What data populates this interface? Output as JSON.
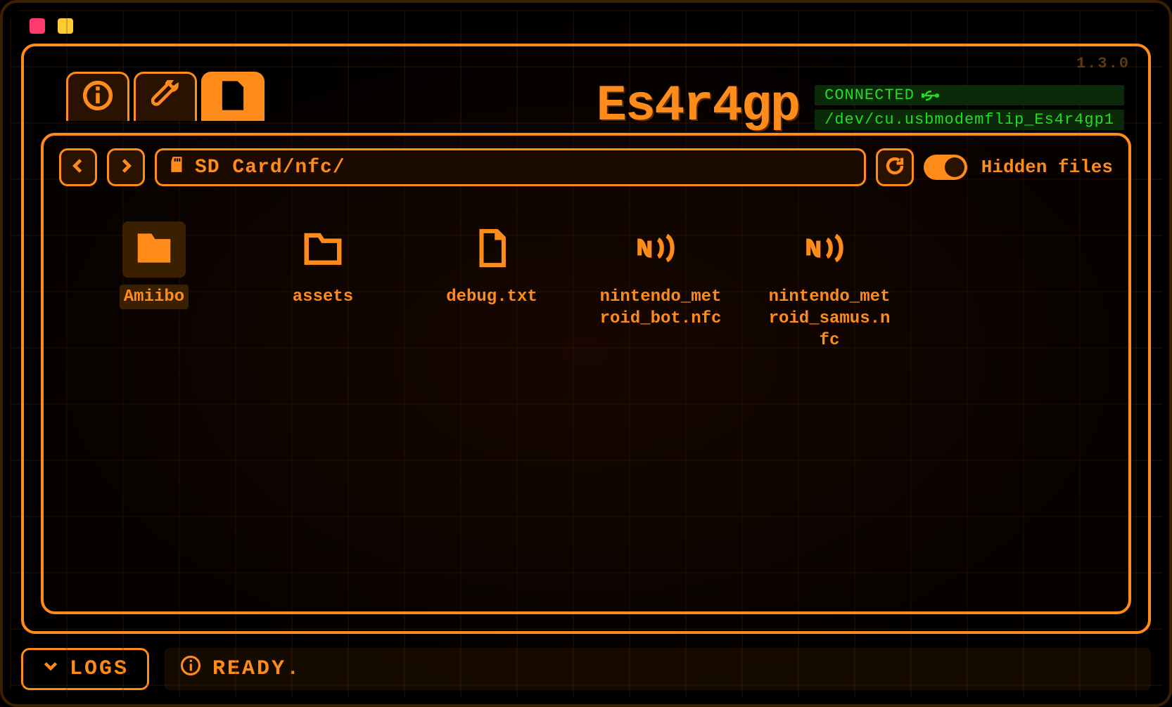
{
  "version": "1.3.0",
  "device": {
    "name": "Es4r4gp",
    "status": "CONNECTED",
    "port": "/dev/cu.usbmodemflip_Es4r4gp1"
  },
  "tabs": [
    {
      "name": "info",
      "active": false
    },
    {
      "name": "tools",
      "active": false
    },
    {
      "name": "files",
      "active": true
    }
  ],
  "toolbar": {
    "path": "SD Card/nfc/",
    "hidden_files_label": "Hidden files",
    "hidden_files_on": true
  },
  "files": [
    {
      "name": "Amiibo",
      "type": "folder",
      "selected": true
    },
    {
      "name": "assets",
      "type": "folder",
      "selected": false
    },
    {
      "name": "debug.txt",
      "type": "file",
      "selected": false
    },
    {
      "name": "nintendo_metroid_bot.nfc",
      "type": "nfc",
      "selected": false
    },
    {
      "name": "nintendo_metroid_samus.nfc",
      "type": "nfc",
      "selected": false
    }
  ],
  "footer": {
    "logs_label": "LOGS",
    "status": "READY."
  }
}
